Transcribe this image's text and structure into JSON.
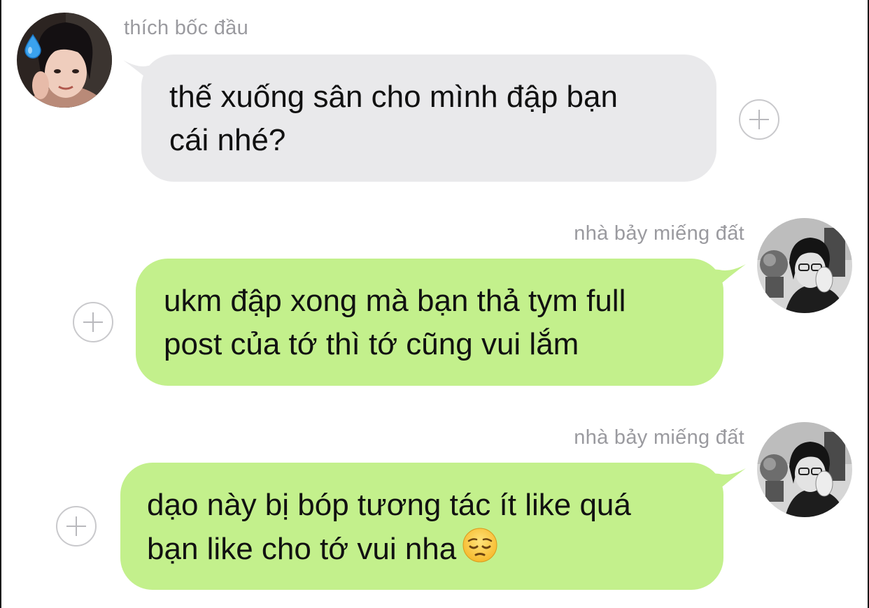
{
  "messages": [
    {
      "sender": "thích bốc đầu",
      "side": "incoming",
      "lines": [
        "thế xuống sân cho mình đập bạn",
        "cái nhé?"
      ],
      "bubble_color": "#e9e9eb"
    },
    {
      "sender": "nhà bảy miếng đất",
      "side": "outgoing",
      "lines": [
        "ukm đập xong mà bạn thả tym full",
        "post của tớ thì tớ cũng vui lắm"
      ],
      "bubble_color": "#c3f08c"
    },
    {
      "sender": "nhà bảy miếng đất",
      "side": "outgoing",
      "lines": [
        "dạo này bị bóp tương tác ít like quá",
        "bạn like cho tớ vui nha"
      ],
      "emoji": "pensive-face",
      "bubble_color": "#c3f08c"
    }
  ],
  "icons": {
    "add_reaction": "plus-circle-icon",
    "sender_badge": "sweat-droplet-icon"
  },
  "colors": {
    "name_text": "#9a9a9f",
    "incoming_bubble": "#e9e9eb",
    "outgoing_bubble": "#c3f08c",
    "message_text": "#111111"
  }
}
